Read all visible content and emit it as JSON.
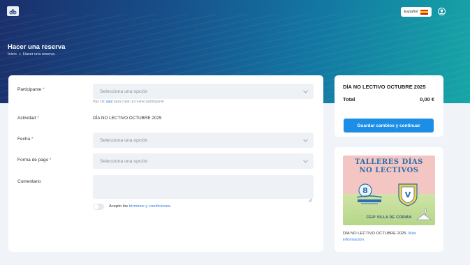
{
  "header": {
    "language_label": "Español",
    "page_title": "Hacer una reserva",
    "breadcrumb": {
      "home": "Inicio",
      "separator": "»",
      "current": "Hacer una reserva"
    }
  },
  "form": {
    "participant": {
      "label": "Participante",
      "required_mark": "*",
      "placeholder": "Selecciona una opción",
      "helper_before": "Haz clic",
      "helper_link": "aquí",
      "helper_after": "para crear un nuevo participante"
    },
    "activity": {
      "label": "Actividad",
      "required_mark": "*",
      "value": "DÍA NO LECTIVO OCTUBRE 2025"
    },
    "date": {
      "label": "Fecha",
      "required_mark": "*",
      "placeholder": "Selecciona una opción"
    },
    "payment": {
      "label": "Forma de pago",
      "required_mark": "*",
      "placeholder": "Selecciona una opción"
    },
    "comment": {
      "label": "Comentario"
    },
    "terms": {
      "prefix": "Acepto los",
      "link": "términos y condiciones",
      "suffix": "."
    }
  },
  "summary": {
    "title": "DÍA NO LECTIVO OCTUBRE 2025",
    "total_label": "Total",
    "total_value": "0,00 €",
    "save_button": "Guardar cambios y continuar"
  },
  "promo": {
    "poster": {
      "title_line1": "TALLERES DÍAS",
      "title_line2": "NO LECTIVOS",
      "bottom_text": "CEIP VILLA DE CORIÁN"
    },
    "description": "DÍA NO LECTIVO OCTUBRE 2025.",
    "more_link": "Más información"
  },
  "colors": {
    "accent": "#1d8ee6",
    "link": "#2c7be5",
    "required": "#e24b4b"
  },
  "icons": [
    "logo-icon",
    "spain-flag-icon",
    "user-icon",
    "chevron-down-icon",
    "resize-handle-icon"
  ]
}
